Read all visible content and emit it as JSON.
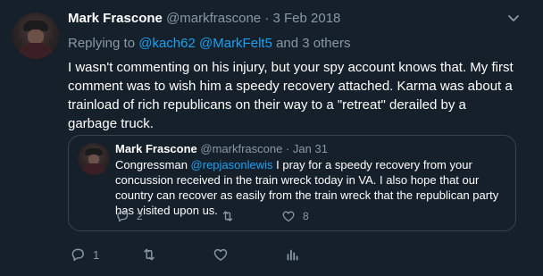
{
  "tweet": {
    "author_name": "Mark Frascone",
    "handle": "@markfrascone",
    "separator": " · ",
    "date": "3 Feb 2018",
    "replying_prefix": "Replying to ",
    "reply_mentions": [
      "@kach62",
      "@MarkFelt5"
    ],
    "reply_suffix": " and 3 others",
    "text": "I wasn't commenting on his injury, but your spy account knows that. My first comment was to wish him a speedy recovery attached. Karma was about a trainload of rich republicans on their way to a \"retreat\" derailed by a garbage truck.",
    "actions": {
      "reply_count": "1",
      "retweet_count": "",
      "like_count": "",
      "stats_label": ""
    }
  },
  "quoted_tweet": {
    "author_name": "Mark Frascone",
    "handle": "@markfrascone",
    "separator": " · ",
    "date": "Jan 31",
    "text_before": "Congressman ",
    "mention": "@repjasonlewis",
    "text_after": "  I pray for a speedy recovery from your concussion received in the train wreck today in VA. I also hope that our country can recover as easily from the train wreck that the republican party has visited upon us.",
    "actions": {
      "reply_count": "2",
      "retweet_count": "",
      "like_count": "8"
    }
  },
  "colors": {
    "background": "#15202b",
    "text_primary": "#ffffff",
    "text_secondary": "#8899a6",
    "link": "#1da1f2",
    "border": "#38444d"
  },
  "icons": [
    "chevron-down-icon",
    "reply-icon",
    "retweet-icon",
    "like-icon",
    "analytics-icon"
  ]
}
